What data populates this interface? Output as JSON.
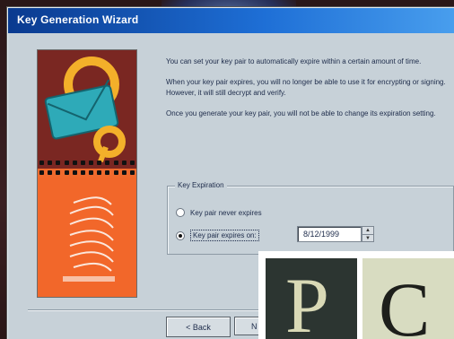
{
  "window": {
    "title": "Key Generation Wizard"
  },
  "content": {
    "paragraphs": [
      "You can set your key pair to automatically expire within a certain amount of time.",
      "When your key pair expires, you will no longer be able to use it for encrypting or signing. However, it will still decrypt and verify.",
      "Once you generate your key pair, you will not be able to change its expiration setting."
    ],
    "group_label": "Key Expiration",
    "options": [
      {
        "label": "Key pair never expires",
        "checked": false
      },
      {
        "label": "Key pair expires on:",
        "checked": true
      }
    ],
    "date_value": "8/12/1999"
  },
  "buttons": {
    "back": "< Back",
    "next": "N"
  },
  "overlay": {
    "left_glyph": "P",
    "right_glyph": "C"
  },
  "colors": {
    "titlebar_start": "#0a3a8f",
    "titlebar_end": "#4da3f0",
    "dialog_bg": "#c7d1d8",
    "art_orange": "#f06a2d",
    "art_dark": "#7a2722"
  },
  "icons": {
    "artwork": "envelope-key-artwork",
    "spin_up": "chevron-up-icon",
    "spin_down": "chevron-down-icon"
  }
}
